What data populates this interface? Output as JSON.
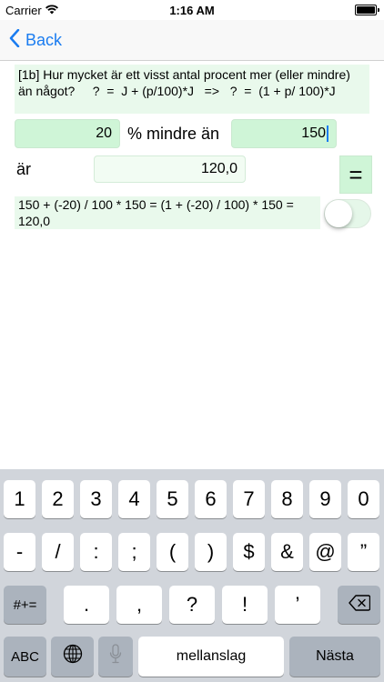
{
  "status": {
    "carrier": "Carrier",
    "time": "1:16 AM"
  },
  "nav": {
    "back_label": "Back"
  },
  "question": {
    "text": "[1b] Hur mycket är ett visst antal procent mer (eller mindre) än något?     ?  =  J + (p/100)*J   =>   ?  =  (1 + p/ 100)*J"
  },
  "inputs": {
    "percent_value": "20",
    "mode_label": "% mindre än",
    "base_value": "150",
    "result_label": "är",
    "result_value": "120,0",
    "equals_label": "="
  },
  "formula": {
    "text": "150 + (-20) / 100 * 150 = (1 + (-20) / 100) * 150 = 120,0"
  },
  "keyboard": {
    "row1": [
      "1",
      "2",
      "3",
      "4",
      "5",
      "6",
      "7",
      "8",
      "9",
      "0"
    ],
    "row2": [
      "-",
      "/",
      ":",
      ";",
      "(",
      ")",
      "$",
      "&",
      "@",
      "”"
    ],
    "row3": [
      ".",
      ",",
      "?",
      "!",
      "’"
    ],
    "shift_label": "#+=",
    "abc_label": "ABC",
    "space_label": "mellanslag",
    "next_label": "Nästa"
  },
  "colors": {
    "accent": "#1a7cf0",
    "field_green": "#cff5d7",
    "panel_green": "#e9f9ec"
  }
}
